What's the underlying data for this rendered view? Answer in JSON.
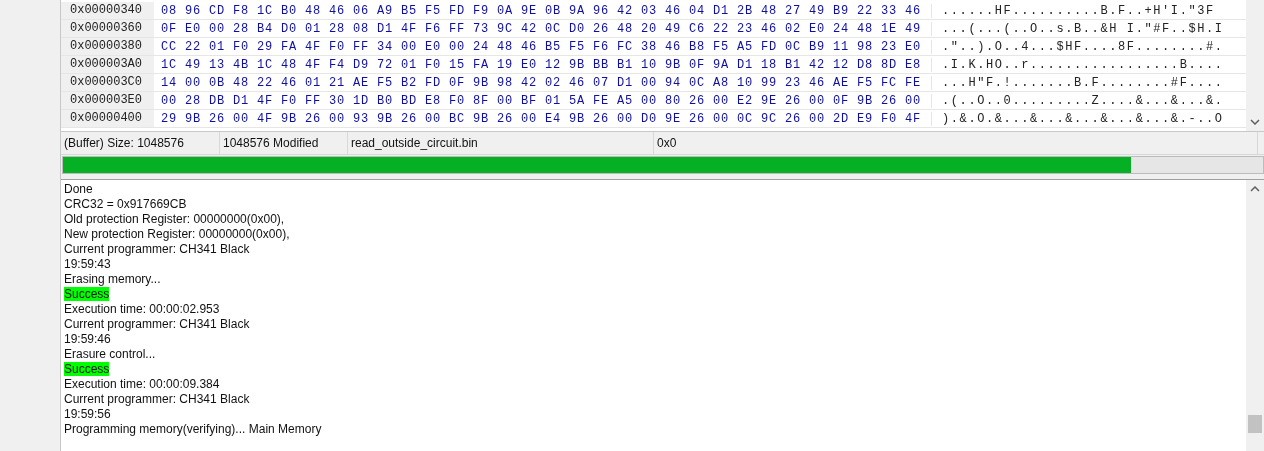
{
  "hex_view": {
    "rows": [
      {
        "address": "0x00000340",
        "bytes": "08 96 CD F8 1C B0 48 46 06 A9 B5 F5 FD F9 0A 9E 0B 9A 96 42 03 46 04 D1 2B 48 27 49 B9 22 33 46",
        "ascii": "......HF..........B.F..+H'I.\"3F"
      },
      {
        "address": "0x00000360",
        "bytes": "0F E0 00 28 B4 D0 01 28 08 D1 4F F6 FF 73 9C 42 0C D0 26 48 20 49 C6 22 23 46 02 E0 24 48 1E 49",
        "ascii": "...(...(..O..s.B..&H I.\"#F..$H.I"
      },
      {
        "address": "0x00000380",
        "bytes": "CC 22 01 F0 29 FA 4F F0 FF 34 00 E0 00 24 48 46 B5 F5 F6 FC 38 46 B8 F5 A5 FD 0C B9 11 98 23 E0",
        "ascii": ".\"..).O..4...$HF....8F........#."
      },
      {
        "address": "0x000003A0",
        "bytes": "1C 49 13 4B 1C 48 4F F4 D9 72 01 F0 15 FA 19 E0 12 9B BB B1 10 9B 0F 9A D1 18 B1 42 12 D8 8D E8",
        "ascii": ".I.K.HO..r.................B...."
      },
      {
        "address": "0x000003C0",
        "bytes": "14 00 0B 48 22 46 01 21 AE F5 B2 FD 0F 9B 98 42 02 46 07 D1 00 94 0C A8 10 99 23 46 AE F5 FC FE",
        "ascii": "...H\"F.!.......B.F........#F...."
      },
      {
        "address": "0x000003E0",
        "bytes": "00 28 DB D1 4F F0 FF 30 1D B0 BD E8 F0 8F 00 BF 01 5A FE A5 00 80 26 00 E2 9E 26 00 0F 9B 26 00",
        "ascii": ".(..O..0.........Z....&...&...&."
      },
      {
        "address": "0x00000400",
        "bytes": "29 9B 26 00 4F 9B 26 00 93 9B 26 00 BC 9B 26 00 E4 9B 26 00 D0 9E 26 00 0C 9C 26 00 2D E9 F0 4F",
        "ascii": ").&.O.&...&...&...&...&...&.-..O"
      }
    ]
  },
  "status_bar": {
    "size": "(Buffer) Size: 1048576",
    "modified": "1048576 Modified",
    "file": "read_outside_circuit.bin",
    "offset": "0x0"
  },
  "progress": {
    "level": 0.89
  },
  "log": [
    {
      "kind": "plain",
      "text": "Done"
    },
    {
      "kind": "plain",
      "text": "CRC32 = 0x917669CB"
    },
    {
      "kind": "plain",
      "text": "Old protection Register: 00000000(0x00),"
    },
    {
      "kind": "plain",
      "text": "New protection Register: 00000000(0x00),"
    },
    {
      "kind": "plain",
      "text": "Current programmer: CH341 Black"
    },
    {
      "kind": "plain",
      "text": "19:59:43"
    },
    {
      "kind": "plain",
      "text": "Erasing memory..."
    },
    {
      "kind": "success",
      "text": "Success"
    },
    {
      "kind": "plain",
      "text": "Execution time: 00:00:02.953"
    },
    {
      "kind": "plain",
      "text": "Current programmer: CH341 Black"
    },
    {
      "kind": "plain",
      "text": "19:59:46"
    },
    {
      "kind": "plain",
      "text": "Erasure control..."
    },
    {
      "kind": "success",
      "text": "Success"
    },
    {
      "kind": "plain",
      "text": "Execution time: 00:00:09.384"
    },
    {
      "kind": "plain",
      "text": "Current programmer: CH341 Black"
    },
    {
      "kind": "plain",
      "text": "19:59:56"
    },
    {
      "kind": "plain",
      "text": "Programming memory(verifying)... Main Memory"
    }
  ]
}
